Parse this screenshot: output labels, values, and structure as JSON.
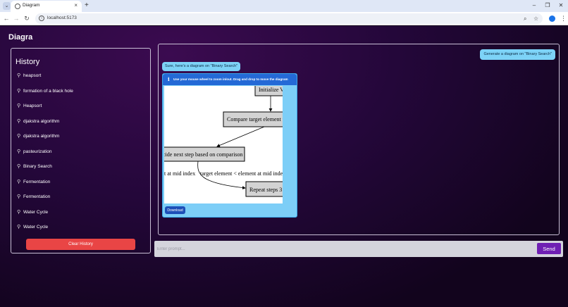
{
  "browser": {
    "tab_title": "Diagram",
    "tab_close": "×",
    "new_tab": "+",
    "tab_menu": "⌄",
    "url": "localhost:5173",
    "window_controls": {
      "minimize": "–",
      "restore": "❐",
      "close": "✕"
    },
    "nav": {
      "back": "←",
      "forward": "→",
      "reload": "↻",
      "info": "i"
    },
    "omni_icons": {
      "zoom": "⌕",
      "bookmark": "☆"
    },
    "menu": "⋮"
  },
  "app": {
    "title": "Diagra",
    "history": {
      "title": "History",
      "clip_glyph": "⚲",
      "items": [
        "heapsort",
        "formation of a black hole",
        "Heapsort",
        "djakstra algorithm",
        "djakstra algorithm",
        "pasteurization",
        "Binary Search",
        "Fermentation",
        "Fermentation",
        "Water Cycle",
        "Water Cycle"
      ],
      "clear_label": "Clear History"
    },
    "chat": {
      "user_message": "Generate a diagram on \"Binary Search\"",
      "bot_message": "Sure, here's a diagram on \"Binary Search\"",
      "diagram": {
        "info_glyph": "i",
        "hint": "Use your mouse wheel to zoom in/out. Drag and drop to move the diagram",
        "nodes": {
          "initialize": "Initialize V",
          "compare": "Compare target element w",
          "decide": "cide next step based on comparison",
          "repeat": "Repeat steps 3 a"
        },
        "edge_labels": {
          "left": "t at mid index",
          "right": "target element < element at mid index"
        },
        "download_label": "Download"
      }
    },
    "input": {
      "placeholder": "Enter prompt...",
      "value": ""
    },
    "send_label": "Send"
  },
  "colors": {
    "accent_purple": "#6f1fb3",
    "clear_red": "#e94545",
    "bubble_blue": "#7dd3f7",
    "header_blue": "#2469d6",
    "node_fill": "#d3d3d3"
  }
}
